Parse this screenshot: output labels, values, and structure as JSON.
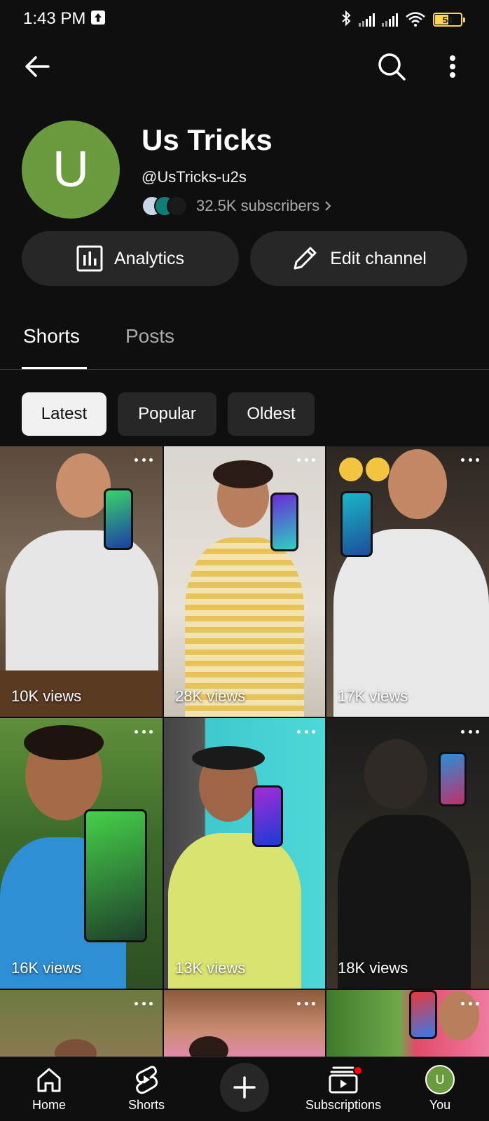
{
  "status_bar": {
    "time": "1:43 PM",
    "battery": "54",
    "battery_level": 0.54,
    "icons": [
      "upload-indicator-icon",
      "bluetooth-icon",
      "signal-icon",
      "signal-icon",
      "wifi-icon",
      "battery-icon"
    ]
  },
  "top_bar": {
    "icons": [
      "back-arrow-icon",
      "search-icon",
      "more-vertical-icon"
    ]
  },
  "channel": {
    "avatar_letter": "U",
    "avatar_color": "#6a9b3c",
    "name": "Us Tricks",
    "handle": "@UsTricks-u2s",
    "subscribers": "32.5K subscribers"
  },
  "actions": {
    "analytics_label": "Analytics",
    "edit_label": "Edit channel"
  },
  "tabs": {
    "shorts": "Shorts",
    "posts": "Posts",
    "active": "Shorts"
  },
  "filters": {
    "latest": "Latest",
    "popular": "Popular",
    "oldest": "Oldest",
    "selected": "Latest"
  },
  "shorts": [
    {
      "views": "10K views"
    },
    {
      "views": "28K views"
    },
    {
      "views": "17K views"
    },
    {
      "views": "16K views"
    },
    {
      "views": "13K views"
    },
    {
      "views": "18K views"
    },
    {
      "views": ""
    },
    {
      "views": ""
    },
    {
      "views": ""
    }
  ],
  "bottom_nav": {
    "home": "Home",
    "shorts": "Shorts",
    "subscriptions": "Subscriptions",
    "you": "You",
    "you_avatar_letter": "U"
  },
  "colors": {
    "background": "#0f0f0f",
    "surface": "#272727",
    "accent_red": "#ff0000",
    "avatar_green": "#6a9b3c"
  }
}
